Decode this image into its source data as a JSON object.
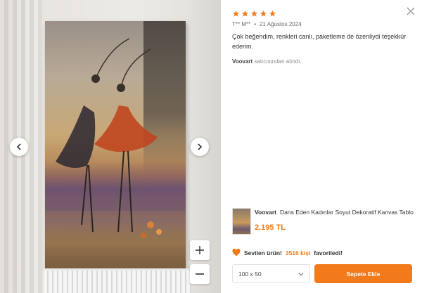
{
  "gallery": {
    "prev_icon": "chevron-left-icon",
    "next_icon": "chevron-right-icon",
    "zoom_in_icon": "plus-icon",
    "zoom_out_icon": "minus-icon"
  },
  "review": {
    "rating": 5,
    "author": "T** M**",
    "separator": "•",
    "date": "21 Ağustos 2024",
    "text": "Çok beğendim, renkleri canlı, paketleme de özenliydi teşekkür ederim.",
    "seller_name": "Voovart",
    "seller_suffix": "satıcısından alındı."
  },
  "product": {
    "brand": "Voovart",
    "name": "Dans Eden Kadınlar Soyut Dekoratif Kanvas Tablo",
    "price": "2.195 TL"
  },
  "favorite": {
    "prefix": "Sevilen ürün!",
    "count_text": "3516 kişi",
    "suffix": "favoriledi!"
  },
  "size": {
    "selected": "100 x 50"
  },
  "cart": {
    "label": "Sepete Ekle"
  },
  "colors": {
    "accent": "#f27a1a",
    "star": "#f27a1a"
  }
}
